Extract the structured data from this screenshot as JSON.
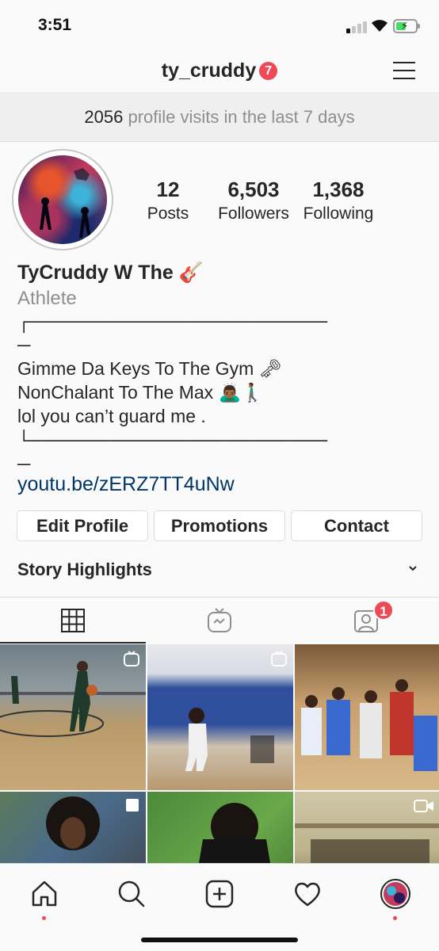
{
  "status_bar": {
    "time": "3:51"
  },
  "header": {
    "username": "ty_cruddy",
    "notification_count": "7"
  },
  "visits": {
    "count": "2056",
    "label": "profile visits in the last 7 days"
  },
  "stats": [
    {
      "value": "12",
      "label": "Posts"
    },
    {
      "value": "6,503",
      "label": "Followers"
    },
    {
      "value": "1,368",
      "label": "Following"
    }
  ],
  "bio": {
    "name": "TyCruddy W The 🎸",
    "category": "Athlete",
    "lines": "┌───────────────────────\n─\nGimme Da Keys To The Gym 🗝\nNonChalant To The Max 🙇🏾‍♂️🚶🏾‍♂️\nlol you can’t guard me .\n└───────────────────────\n─",
    "link": "youtu.be/zERZ7TT4uNw"
  },
  "buttons": {
    "edit_profile": "Edit Profile",
    "promotions": "Promotions",
    "contact": "Contact"
  },
  "highlights": {
    "label": "Story Highlights"
  },
  "tabs": {
    "tagged_badge": "1"
  },
  "icons": {
    "home": "home-icon",
    "search": "search-icon",
    "add": "add-post-icon",
    "activity": "heart-icon",
    "profile": "profile-avatar-icon",
    "grid": "grid-icon",
    "igtv": "igtv-icon",
    "tagged": "tagged-icon"
  },
  "colors": {
    "accent_red": "#ed4956",
    "link": "#003569",
    "muted": "#8e8e8e"
  }
}
